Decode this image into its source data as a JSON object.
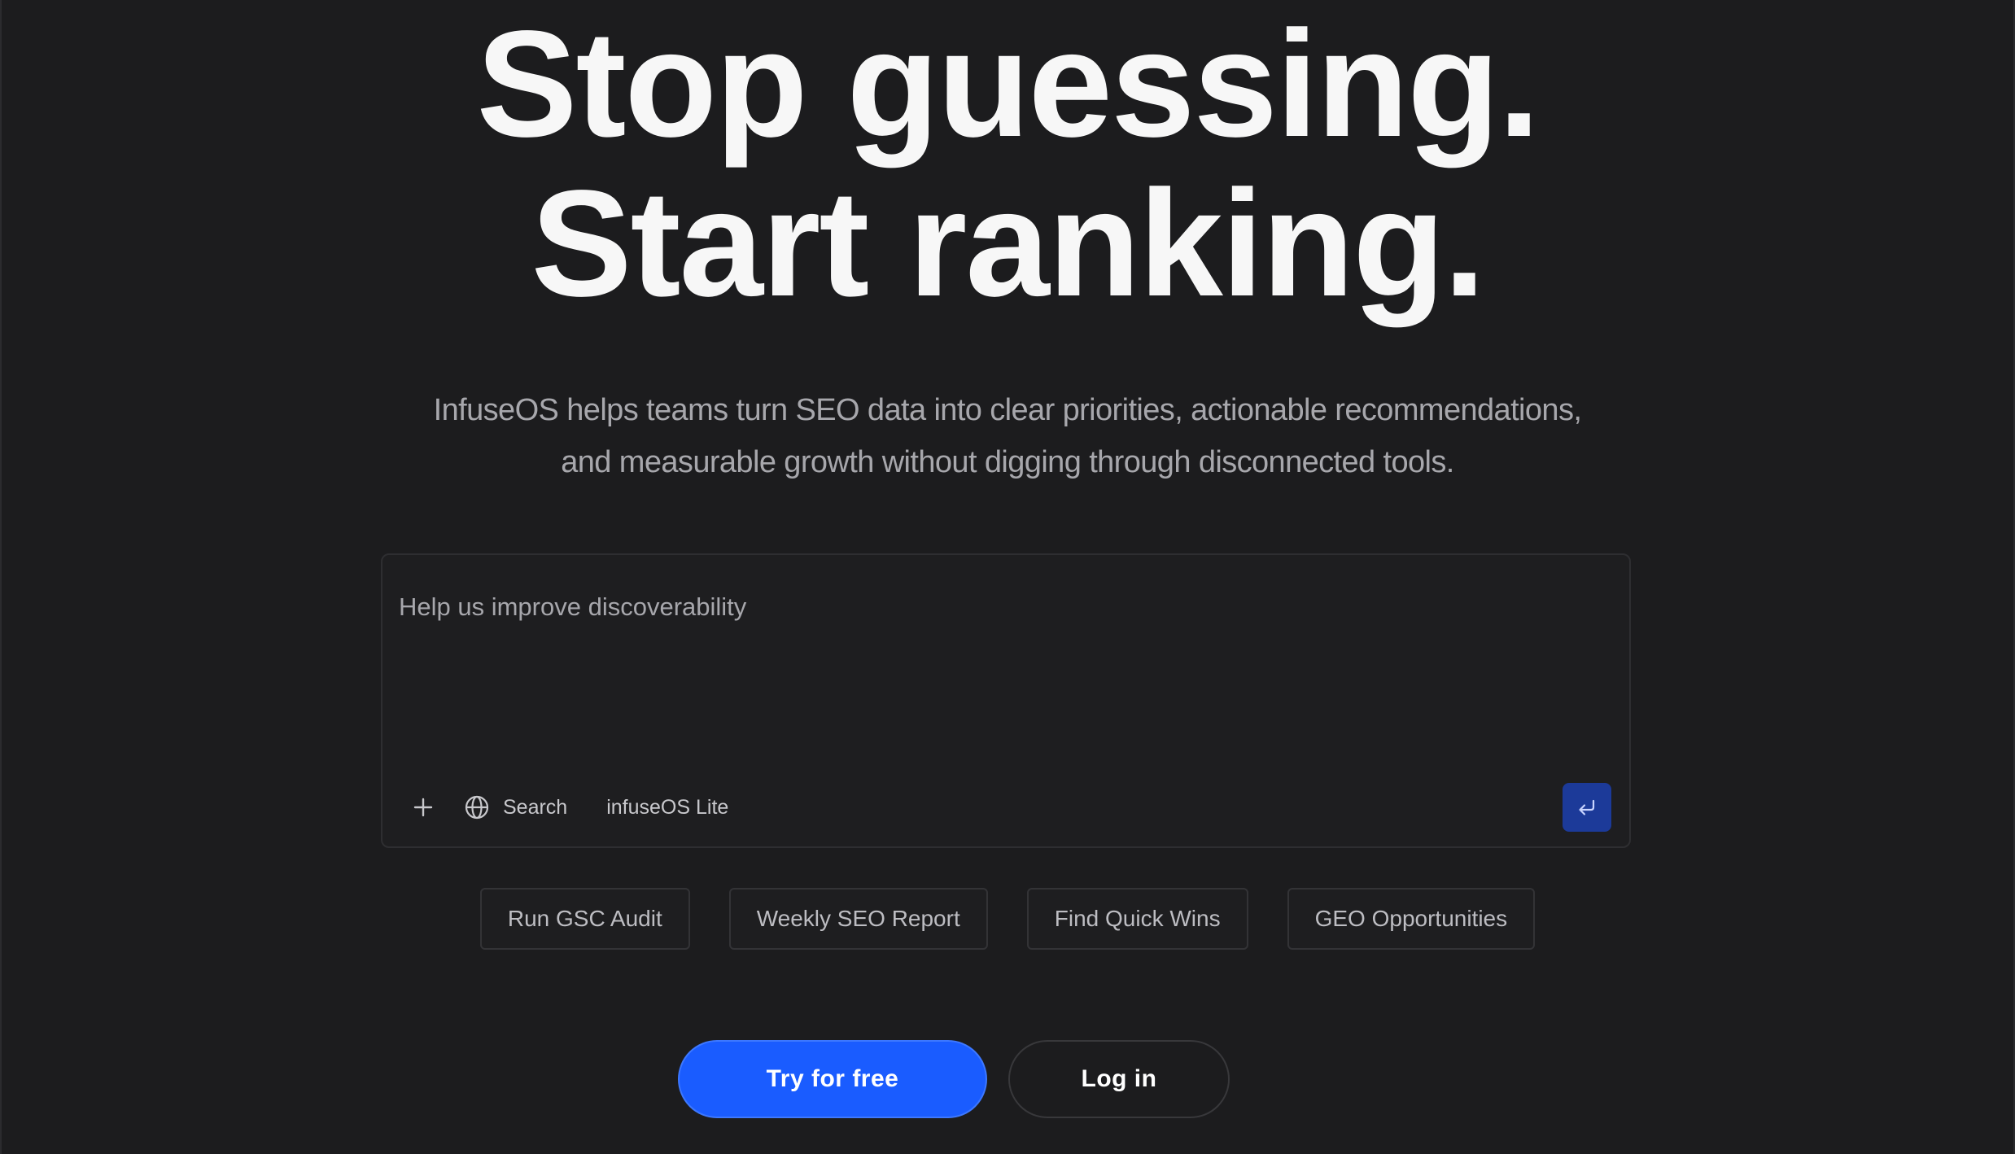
{
  "hero": {
    "headline_line1": "Stop guessing.",
    "headline_line2": "Start ranking.",
    "subtitle_line1": "InfuseOS helps teams turn SEO data into clear priorities, actionable recommendations,",
    "subtitle_line2": "and measurable growth without digging through disconnected tools."
  },
  "prompt": {
    "placeholder": "Help us improve discoverability",
    "value": "",
    "toolbar": {
      "add_icon": "plus-icon",
      "search_icon": "globe-icon",
      "search_label": "Search",
      "model_label": "infuseOS Lite",
      "submit_icon": "enter-return-icon"
    }
  },
  "suggestions": [
    {
      "label": "Run GSC Audit"
    },
    {
      "label": "Weekly SEO Report"
    },
    {
      "label": "Find Quick Wins"
    },
    {
      "label": "GEO Opportunities"
    }
  ],
  "cta": {
    "primary_label": "Try for free",
    "secondary_label": "Log in"
  },
  "colors": {
    "background": "#1c1c1e",
    "primary_button": "#1a5cff",
    "submit_button": "#1c3a99",
    "subtitle_text": "#a7a7ac"
  }
}
